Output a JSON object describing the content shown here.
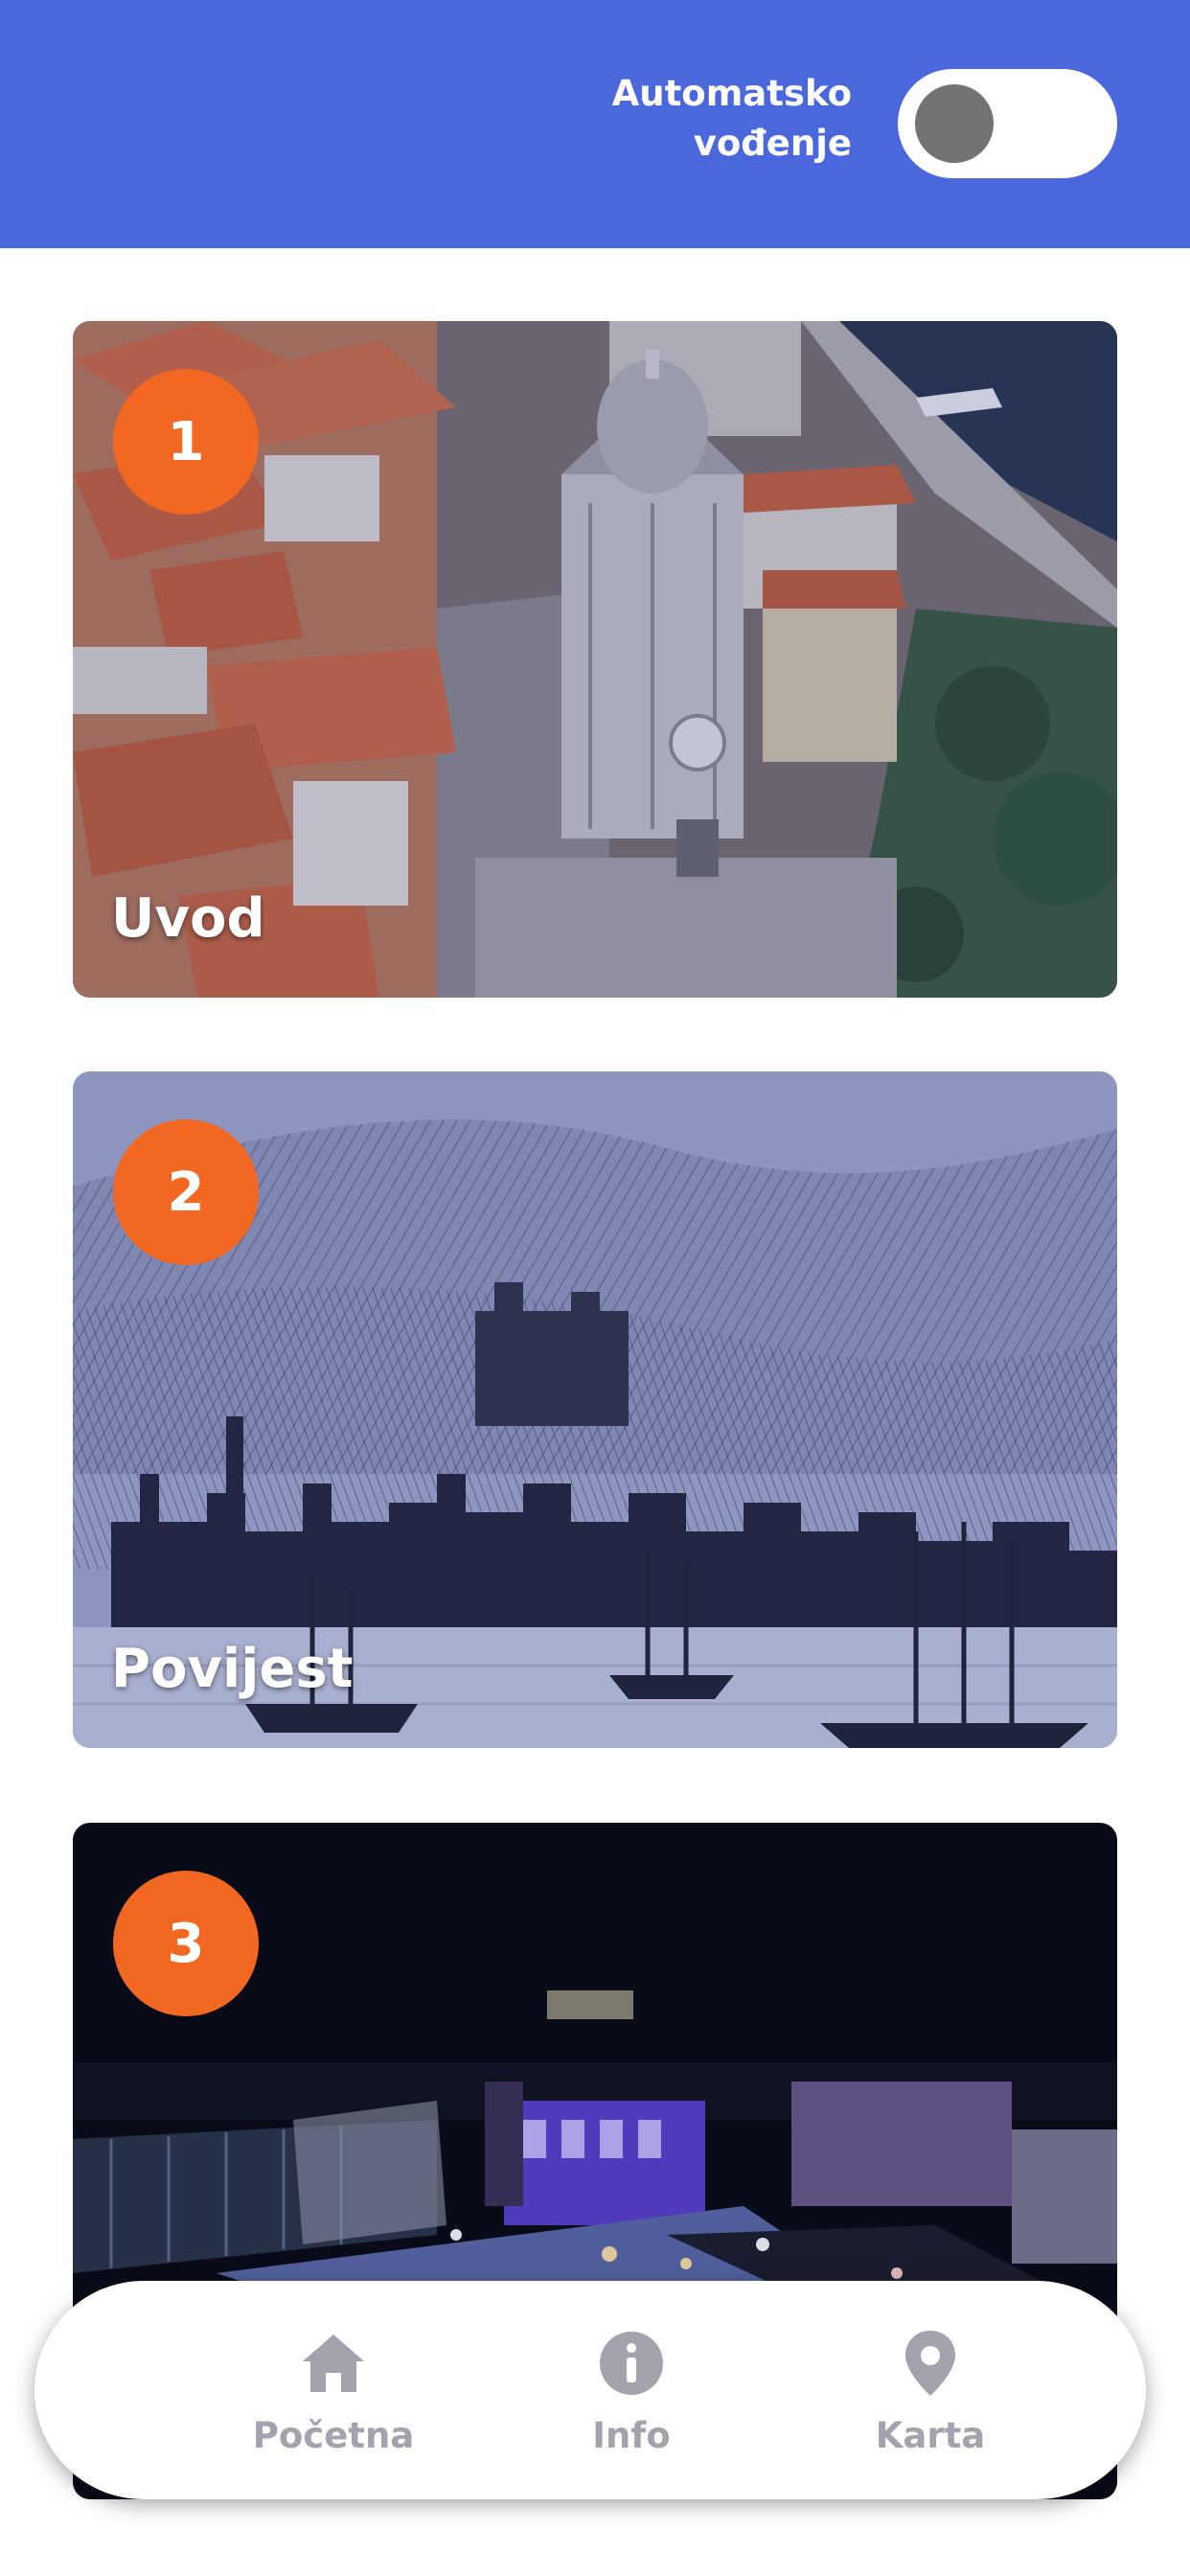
{
  "header": {
    "auto_guide_label_line1": "Automatsko",
    "auto_guide_label_line2": "vođenje",
    "auto_guide_enabled": false,
    "background_color": "#4a68dc"
  },
  "cards": [
    {
      "number": "1",
      "title": "Uvod",
      "image": "aerial-cathedral-town-photo"
    },
    {
      "number": "2",
      "title": "Povijest",
      "image": "historical-town-engraving"
    },
    {
      "number": "3",
      "title": "",
      "image": "night-square-photo"
    }
  ],
  "bottom_nav": {
    "items": [
      {
        "label": "Početna",
        "icon": "home-icon"
      },
      {
        "label": "Info",
        "icon": "info-icon"
      },
      {
        "label": "Karta",
        "icon": "map-pin-icon"
      }
    ]
  },
  "colors": {
    "accent_orange": "#f26722",
    "nav_inactive": "#a3a3ad",
    "toggle_knob": "#737373"
  }
}
